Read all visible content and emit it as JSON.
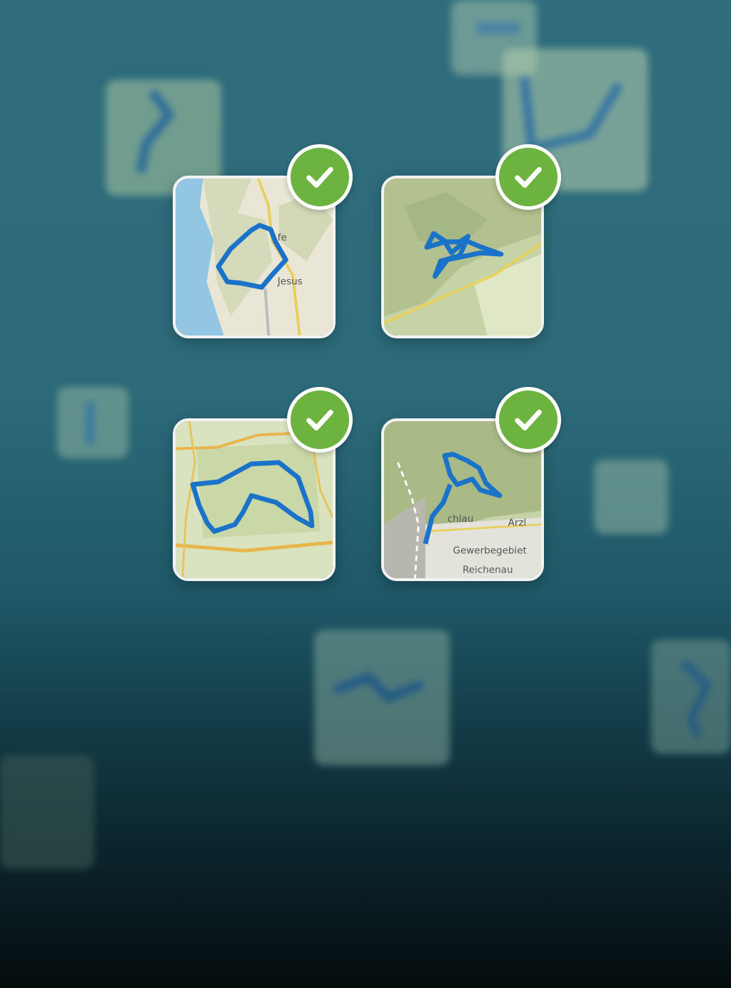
{
  "background_tiles": [
    {
      "name": "bg-tile-top-left"
    },
    {
      "name": "bg-tile-top-right-small"
    },
    {
      "name": "bg-tile-top-right"
    },
    {
      "name": "bg-tile-mid-left"
    },
    {
      "name": "bg-tile-mid-right"
    },
    {
      "name": "bg-tile-bottom-center"
    },
    {
      "name": "bg-tile-bottom-right"
    },
    {
      "name": "bg-tile-bottom-left"
    }
  ],
  "cards": [
    {
      "id": "card-1",
      "labels": [
        "fe",
        "Jesus"
      ],
      "checked": true
    },
    {
      "id": "card-2",
      "labels": [],
      "checked": true
    },
    {
      "id": "card-3",
      "labels": [],
      "checked": true
    },
    {
      "id": "card-4",
      "labels": [
        "chlau",
        "Arzl",
        "Gewerbegebiet",
        "Reichenau"
      ],
      "checked": true
    }
  ],
  "colors": {
    "route": "#1a73c9",
    "check_green": "#6db33f",
    "card_border": "#f2f2f2"
  },
  "icons": {
    "check": "check-icon"
  }
}
